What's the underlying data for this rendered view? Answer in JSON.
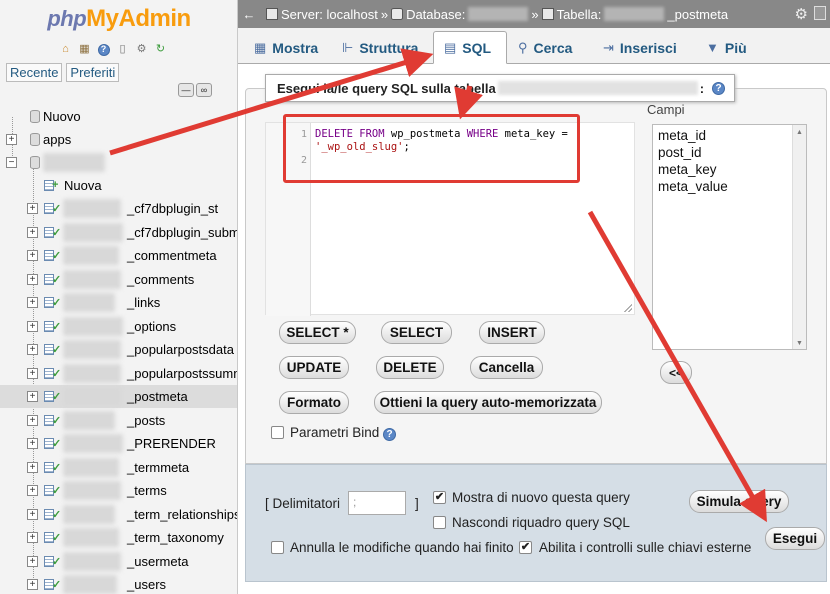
{
  "colors": {
    "accent_link": "#235a81",
    "top_bar": "#888888",
    "annotation_red": "#e03b33",
    "logo_blue": "#6c78af",
    "logo_orange": "#f89c0e"
  },
  "nav": {
    "logo_php": "php",
    "logo_myadmin": "MyAdmin",
    "logo_icons": [
      "home-icon",
      "exit-icon",
      "help-icon",
      "docs-icon",
      "settings-icon",
      "reload-icon"
    ],
    "tabs": [
      "Recente",
      "Preferiti"
    ],
    "tree": [
      {
        "label": "Nuovo",
        "kind": "new"
      },
      {
        "label": "apps",
        "kind": "db"
      },
      {
        "label": "",
        "kind": "db-open"
      },
      {
        "label": "Nuova",
        "kind": "new-table"
      },
      {
        "label": "_cf7dbplugin_st",
        "kind": "table"
      },
      {
        "label": "_cf7dbplugin_subm",
        "kind": "table"
      },
      {
        "label": "_commentmeta",
        "kind": "table"
      },
      {
        "label": "_comments",
        "kind": "table"
      },
      {
        "label": "_links",
        "kind": "table"
      },
      {
        "label": "_options",
        "kind": "table"
      },
      {
        "label": "_popularpostsdata",
        "kind": "table"
      },
      {
        "label": "_popularpostssumm",
        "kind": "table"
      },
      {
        "label": "_postmeta",
        "kind": "table",
        "selected": true
      },
      {
        "label": "_posts",
        "kind": "table"
      },
      {
        "label": "_PRERENDER",
        "kind": "table"
      },
      {
        "label": "_termmeta",
        "kind": "table"
      },
      {
        "label": "_terms",
        "kind": "table"
      },
      {
        "label": "_term_relationships",
        "kind": "table"
      },
      {
        "label": "_term_taxonomy",
        "kind": "table"
      },
      {
        "label": "_usermeta",
        "kind": "table"
      },
      {
        "label": "_users",
        "kind": "table"
      }
    ]
  },
  "breadcrumb": {
    "server": "Server: localhost",
    "database": "Database:",
    "table_prefix": "Tabella:",
    "table_suffix": "_postmeta"
  },
  "tabs": [
    {
      "label": "Mostra",
      "icon": "browse-icon"
    },
    {
      "label": "Struttura",
      "icon": "structure-icon"
    },
    {
      "label": "SQL",
      "icon": "sql-icon",
      "active": true
    },
    {
      "label": "Cerca",
      "icon": "search-icon"
    },
    {
      "label": "Inserisci",
      "icon": "insert-icon"
    },
    {
      "label": "Più",
      "icon": "more-icon"
    }
  ],
  "sql": {
    "legend_prefix": "Esegui la/le query SQL sulla tabella",
    "legend_suffix": ":",
    "line_numbers": [
      "1",
      "2"
    ],
    "query_keyword_1": "DELETE FROM",
    "query_table": " wp_postmeta ",
    "query_keyword_2": "WHERE",
    "query_rest": " meta_key =",
    "query_string": "'_wp_old_slug'",
    "query_end": ";",
    "buttons": {
      "select_all": "SELECT *",
      "select": "SELECT",
      "insert": "INSERT",
      "update": "UPDATE",
      "delete": "DELETE",
      "clear": "Cancella",
      "format": "Formato",
      "bookmark": "Ottieni la query auto-memorizzata"
    },
    "bind_params_label": "Parametri Bind",
    "columns_label": "Campi",
    "columns": [
      "meta_id",
      "post_id",
      "meta_key",
      "meta_value"
    ],
    "insert_column_btn": "<<"
  },
  "options": {
    "delimiter_label_open": "[ Delimitatori",
    "delimiter_value": ";",
    "delimiter_label_close": "]",
    "show_query_again": {
      "label": "Mostra di nuovo questa query",
      "checked": true
    },
    "hide_query_box": {
      "label": "Nascondi riquadro query SQL",
      "checked": false
    },
    "rollback_label": {
      "label": "Annulla le modifiche quando hai finito",
      "checked": false
    },
    "foreign_key_checks": {
      "label": "Abilita i controlli sulle chiavi esterne",
      "checked": true
    },
    "simulate_btn": "Simula query",
    "go_btn": "Esegui"
  }
}
